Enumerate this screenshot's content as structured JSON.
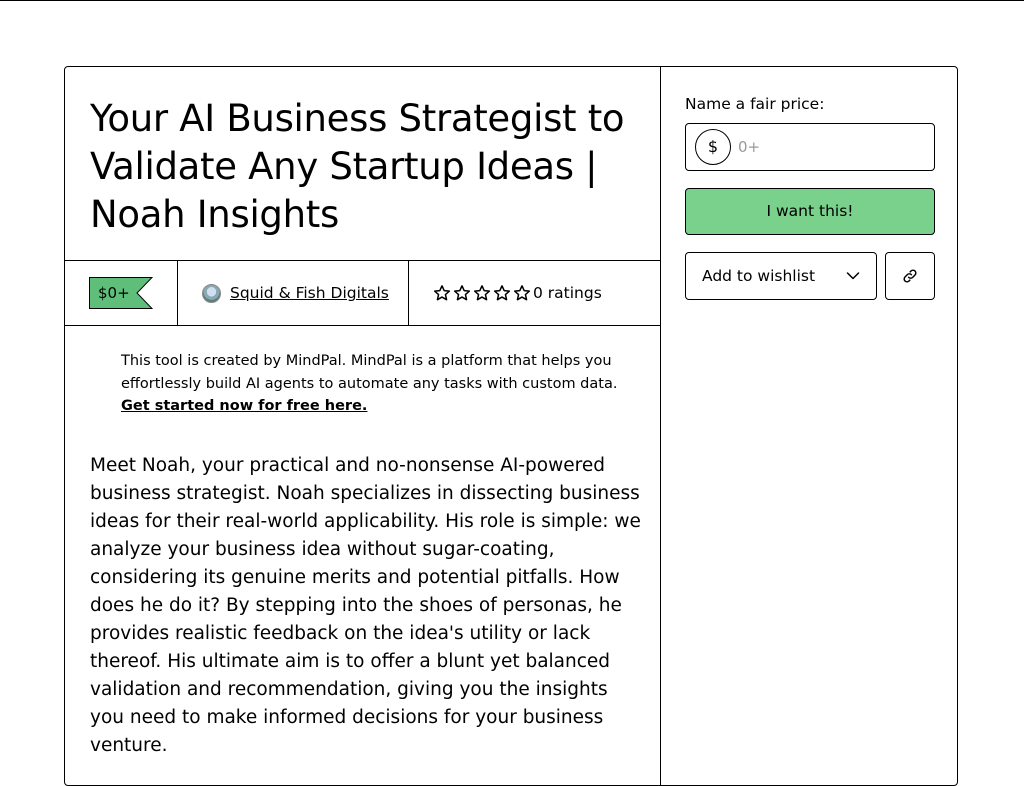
{
  "product": {
    "title": "Your AI Business Strategist to Validate Any Startup Ideas | Noah Insights",
    "price_tag": "$0+",
    "creator_name": "Squid & Fish Digitals",
    "rating": {
      "stars_filled": 0,
      "stars_total": 5,
      "text": "0 ratings"
    }
  },
  "notice": {
    "text": "This tool is created by MindPal. MindPal is a platform that helps you effortlessly build AI agents to automate any tasks with custom data. ",
    "link_text": "Get started now for free here."
  },
  "description": "Meet Noah, your practical and no-nonsense AI-powered business strategist. Noah specializes in dissecting business ideas for their real-world applicability. His role is simple: we analyze your business idea without sugar-coating, considering its genuine merits and potential pitfalls. How does he do it? By stepping into the shoes of personas, he provides realistic feedback on the idea's utility or lack thereof. His ultimate aim is to offer a blunt yet balanced validation and recommendation, giving you the insights you need to make informed decisions for your business venture.",
  "purchase": {
    "price_label": "Name a fair price:",
    "currency_symbol": "$",
    "price_placeholder": "0+",
    "price_value": "",
    "buy_label": "I want this!",
    "wishlist_label": "Add to wishlist"
  },
  "colors": {
    "accent_green": "#7ad18b",
    "price_tag_green": "#5fbf7a",
    "border": "#000000"
  },
  "icons": {
    "stars": "star-outline-icon",
    "wishlist_dropdown": "chevron-down-icon",
    "share": "link-icon",
    "creator": "avatar"
  }
}
